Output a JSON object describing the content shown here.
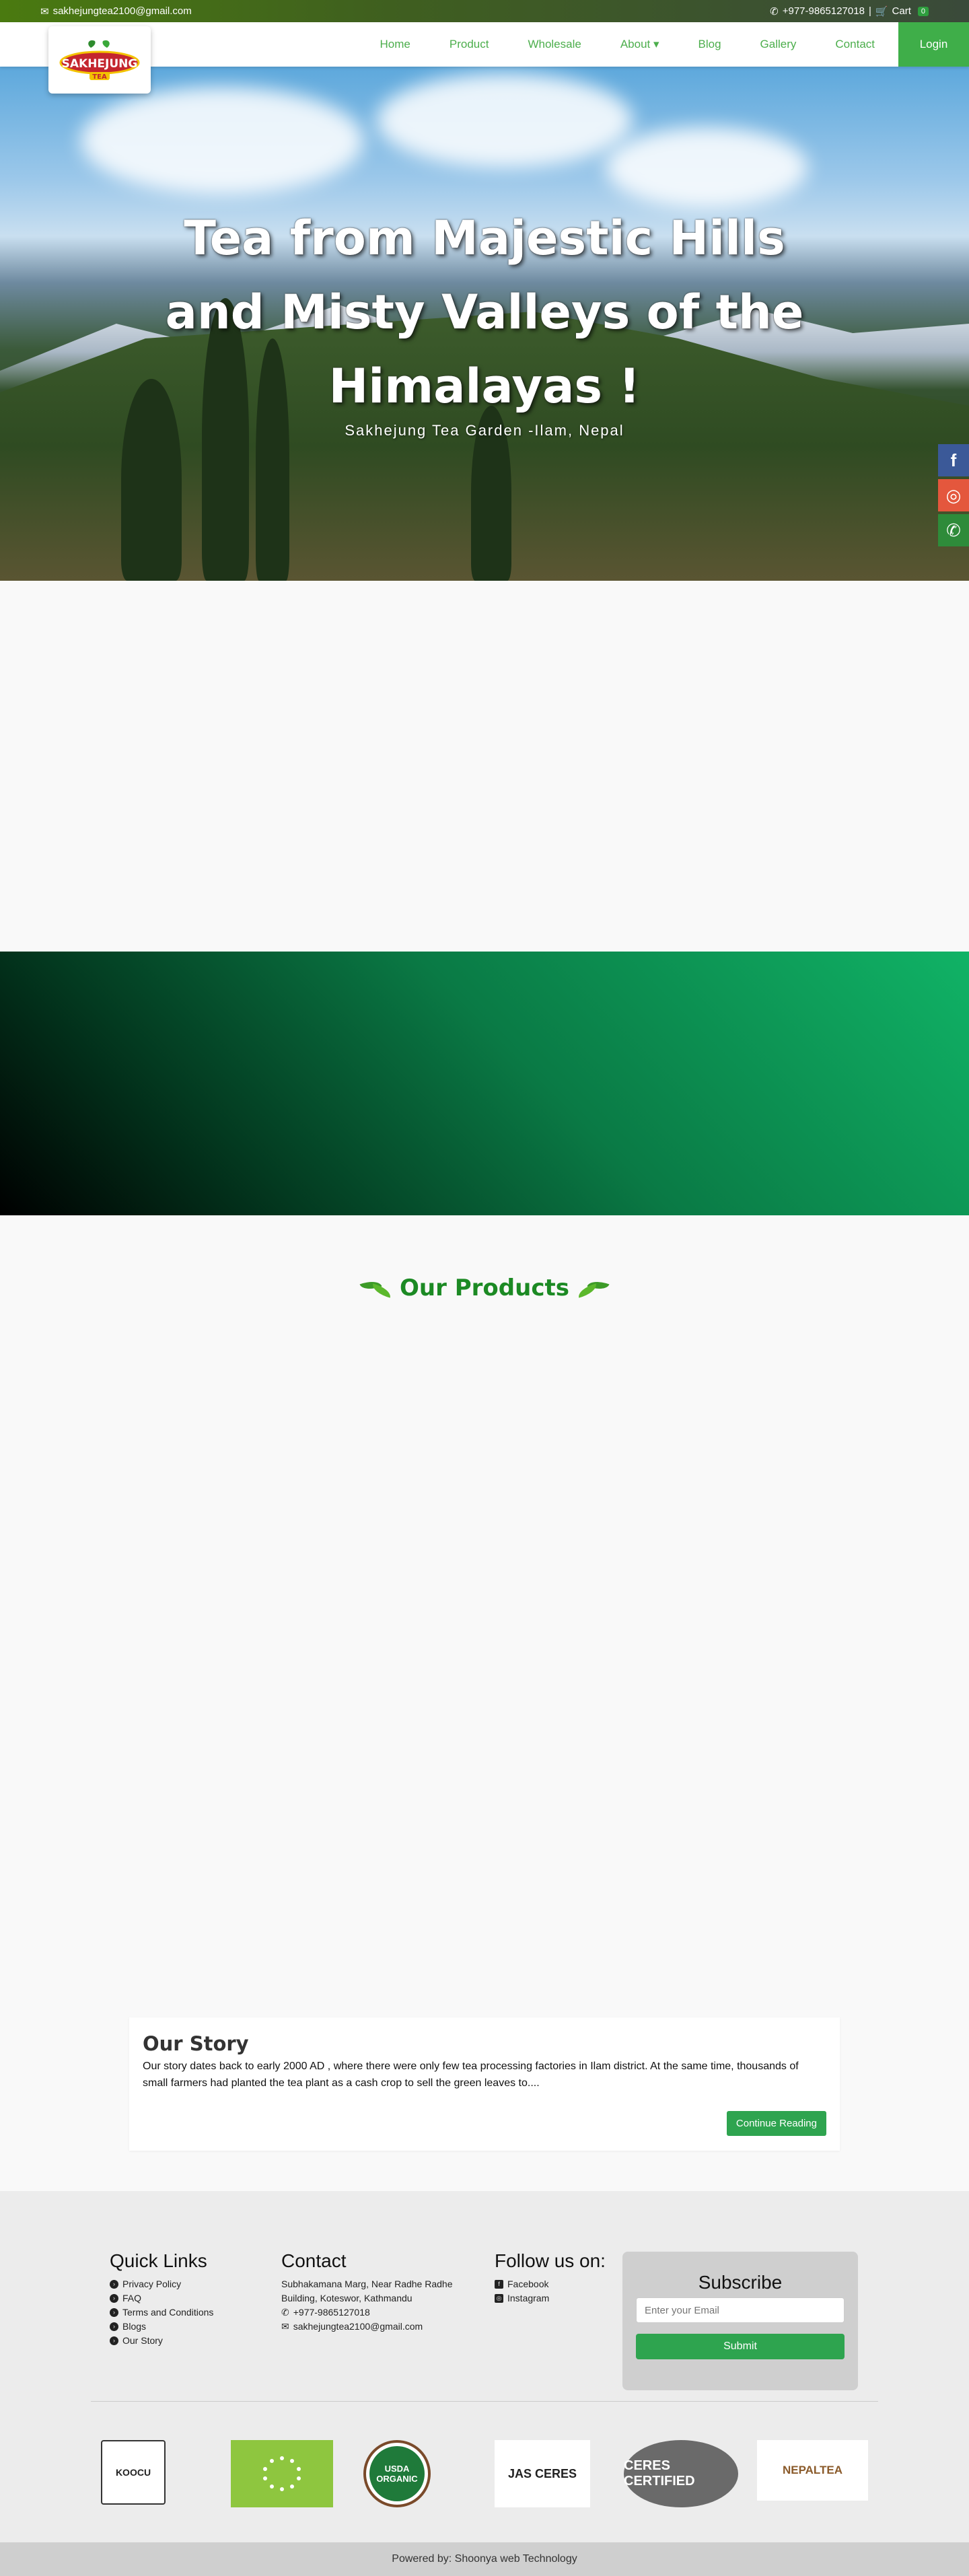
{
  "topbar": {
    "email": "sakhejungtea2100@gmail.com",
    "phone": "+977-9865127018",
    "separator": "|",
    "cart_label": "Cart",
    "cart_count": "0"
  },
  "nav": {
    "logo_text": "SAKHEJUNG",
    "logo_sub": "TEA",
    "items": [
      {
        "label": "Home"
      },
      {
        "label": "Product"
      },
      {
        "label": "Wholesale"
      },
      {
        "label": "About ▾"
      },
      {
        "label": "Blog"
      },
      {
        "label": "Gallery"
      },
      {
        "label": "Contact"
      }
    ],
    "login": "Login"
  },
  "hero": {
    "title": "Tea from Majestic Hills and Misty Valleys of the Himalayas !",
    "subtitle": "Sakhejung Tea Garden -Ilam, Nepal"
  },
  "products": {
    "title": "Our Products"
  },
  "story": {
    "title": "Our Story",
    "text": "Our story dates back to early 2000 AD , where there were only few tea processing factories in Ilam district. At the same time, thousands of small farmers had planted the tea plant as a cash crop to sell the green leaves to....",
    "button": "Continue Reading"
  },
  "footer": {
    "quick_links": {
      "title": "Quick Links",
      "items": [
        {
          "label": "Privacy Policy"
        },
        {
          "label": "FAQ"
        },
        {
          "label": "Terms and Conditions"
        },
        {
          "label": "Blogs"
        },
        {
          "label": "Our Story"
        }
      ]
    },
    "contact": {
      "title": "Contact",
      "address": "Subhakamana Marg, Near Radhe Radhe Building, Koteswor, Kathmandu",
      "phone": "+977-9865127018",
      "email": "sakhejungtea2100@gmail.com"
    },
    "follow": {
      "title": "Follow us on:",
      "facebook": "Facebook",
      "instagram": "Instagram"
    },
    "subscribe": {
      "title": "Subscribe",
      "placeholder": "Enter your Email",
      "button": "Submit"
    },
    "certs": [
      {
        "label": "KOOCU"
      },
      {
        "label": ""
      },
      {
        "label": "USDA ORGANIC"
      },
      {
        "label": "JAS CERES"
      },
      {
        "label": "CERES CERTIFIED"
      },
      {
        "label": "NEPALTEA"
      }
    ],
    "powered_by": "Powered by: Shoonya web Technology"
  },
  "colors": {
    "brand_green": "#3fae49",
    "button_green": "#2ea44f",
    "title_green": "#1c8a24",
    "facebook_blue": "#3b5998",
    "instagram_orange": "#e4573d"
  }
}
